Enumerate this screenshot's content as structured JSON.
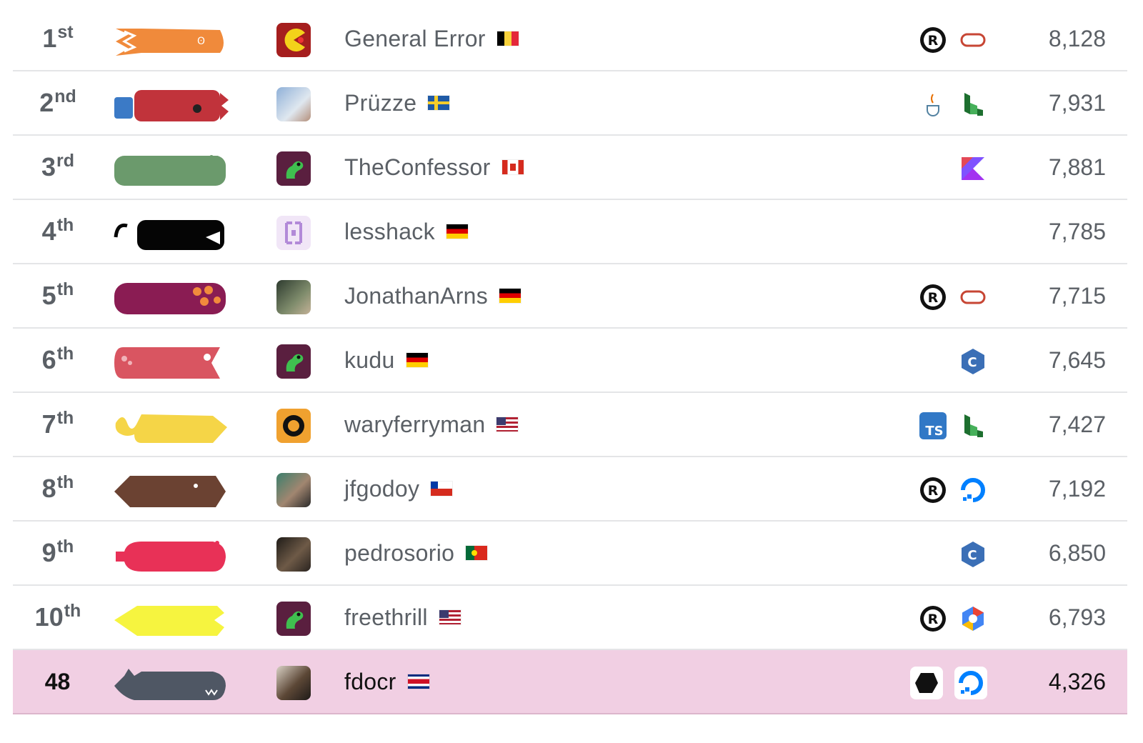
{
  "leaderboard": {
    "rows": [
      {
        "rank": "1",
        "suffix": "st",
        "player": "General Error",
        "flag": "belgium",
        "score": "8,128",
        "snake_color": "#f08a3b",
        "avatar": "pacman-avatar",
        "langs": [
          "rust-icon",
          "oracle-icon"
        ]
      },
      {
        "rank": "2",
        "suffix": "nd",
        "player": "Prüzze",
        "flag": "sweden",
        "score": "7,931",
        "snake_color": "#c1333b",
        "avatar": "photo-avatar",
        "langs": [
          "java-icon",
          "linode-icon"
        ]
      },
      {
        "rank": "3",
        "suffix": "rd",
        "player": "TheConfessor",
        "flag": "canada",
        "score": "7,881",
        "snake_color": "#6b9a6c",
        "avatar": "snake-avatar",
        "langs": [
          "kotlin-icon"
        ]
      },
      {
        "rank": "4",
        "suffix": "th",
        "player": "lesshack",
        "flag": "germany",
        "score": "7,785",
        "snake_color": "#050505",
        "avatar": "bracket-avatar",
        "langs": []
      },
      {
        "rank": "5",
        "suffix": "th",
        "player": "JonathanArns",
        "flag": "germany",
        "score": "7,715",
        "snake_color": "#8a1c53",
        "avatar": "photo-avatar",
        "langs": [
          "rust-icon",
          "oracle-icon"
        ]
      },
      {
        "rank": "6",
        "suffix": "th",
        "player": "kudu",
        "flag": "germany",
        "score": "7,645",
        "snake_color": "#d95561",
        "avatar": "snake-avatar",
        "langs": [
          "cpp-icon"
        ]
      },
      {
        "rank": "7",
        "suffix": "th",
        "player": "waryferryman",
        "flag": "usa",
        "score": "7,427",
        "snake_color": "#f5d547",
        "avatar": "gear-avatar",
        "langs": [
          "typescript-icon",
          "linode-icon"
        ]
      },
      {
        "rank": "8",
        "suffix": "th",
        "player": "jfgodoy",
        "flag": "chile",
        "score": "7,192",
        "snake_color": "#6b4232",
        "avatar": "photo-avatar",
        "langs": [
          "rust-icon",
          "digitalocean-icon"
        ]
      },
      {
        "rank": "9",
        "suffix": "th",
        "player": "pedrosorio",
        "flag": "portugal",
        "score": "6,850",
        "snake_color": "#e83157",
        "avatar": "photo-avatar",
        "langs": [
          "cpp-icon"
        ]
      },
      {
        "rank": "10",
        "suffix": "th",
        "player": "freethrill",
        "flag": "usa",
        "score": "6,793",
        "snake_color": "#f6f43f",
        "avatar": "snake-avatar",
        "langs": [
          "rust-icon",
          "gcp-icon"
        ]
      },
      {
        "rank": "48",
        "suffix": "",
        "player": "fdocr",
        "flag": "costa-rica",
        "score": "4,326",
        "snake_color": "#4f5764",
        "avatar": "photo-avatar",
        "langs": [
          "game-icon",
          "digitalocean-icon"
        ],
        "highlight": true
      }
    ]
  },
  "colors": {
    "highlight_row": "#f1cfe3",
    "text": "#5b6066",
    "divider": "#e4e5e7"
  }
}
